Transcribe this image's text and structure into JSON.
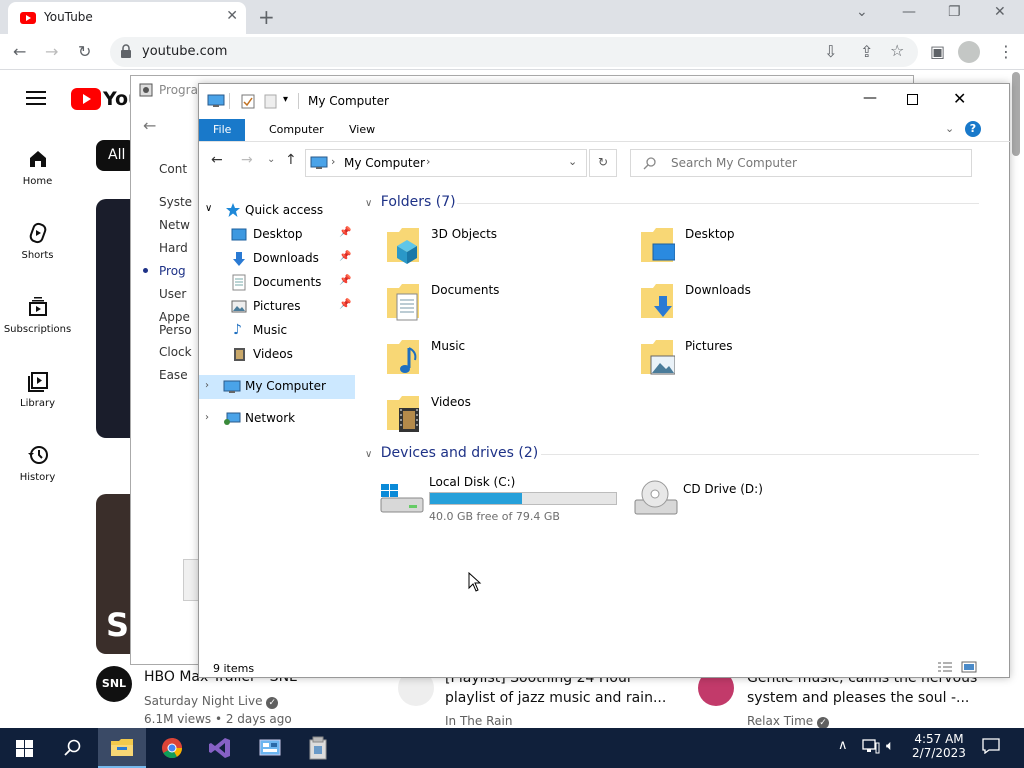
{
  "browser": {
    "tab_title": "YouTube",
    "url": "youtube.com"
  },
  "youtube": {
    "logo_text": "You",
    "sidebar": [
      {
        "label": "Home",
        "icon": "home-icon"
      },
      {
        "label": "Shorts",
        "icon": "shorts-icon"
      },
      {
        "label": "Subscriptions",
        "icon": "subscriptions-icon"
      },
      {
        "label": "Library",
        "icon": "library-icon"
      },
      {
        "label": "History",
        "icon": "history-icon"
      }
    ],
    "chip_all": "All",
    "videos": [
      {
        "title": "HBO Max Trailer - SNL",
        "channel": "Saturday Night Live",
        "meta": "6.1M views • 2 days ago",
        "avatar_text": "SNL"
      },
      {
        "title": "[Playlist] Soothing 24 Hour playlist of jazz music and rain...",
        "channel": "In The Rain",
        "meta": ""
      },
      {
        "title": "Gentle music, calms the nervous system and pleases the soul -...",
        "channel": "Relax Time",
        "meta": ""
      }
    ]
  },
  "control_panel": {
    "title": "Progra",
    "items": [
      "Cont",
      "Syste",
      "Netw",
      "Hard",
      "Prog",
      "User",
      "Appe",
      "Perso",
      "Clock",
      "Ease"
    ]
  },
  "explorer": {
    "title": "My Computer",
    "ribbon_tabs": [
      "File",
      "Computer",
      "View"
    ],
    "address": "My Computer",
    "search_placeholder": "Search My Computer",
    "nav": {
      "quick_access": "Quick access",
      "quick_items": [
        "Desktop",
        "Downloads",
        "Documents",
        "Pictures",
        "Music",
        "Videos"
      ],
      "my_computer": "My Computer",
      "network": "Network"
    },
    "folders_header": "Folders (7)",
    "folders": [
      "3D Objects",
      "Desktop",
      "Documents",
      "Downloads",
      "Music",
      "Pictures",
      "Videos"
    ],
    "drives_header": "Devices and drives (2)",
    "drives": [
      {
        "name": "Local Disk (C:)",
        "free": "40.0 GB free of 79.4 GB",
        "used_fraction": 0.496
      },
      {
        "name": "CD Drive (D:)",
        "free": ""
      }
    ],
    "status": "9 items"
  },
  "taskbar": {
    "time": "4:57 AM",
    "date": "2/7/2023"
  },
  "colors": {
    "accent": "#0078d7",
    "ribbon_file": "#1979ca",
    "youtube_red": "#ff0000",
    "taskbar": "#10203b",
    "drive_bar": "#26a0da",
    "folder": "#f8d775"
  }
}
